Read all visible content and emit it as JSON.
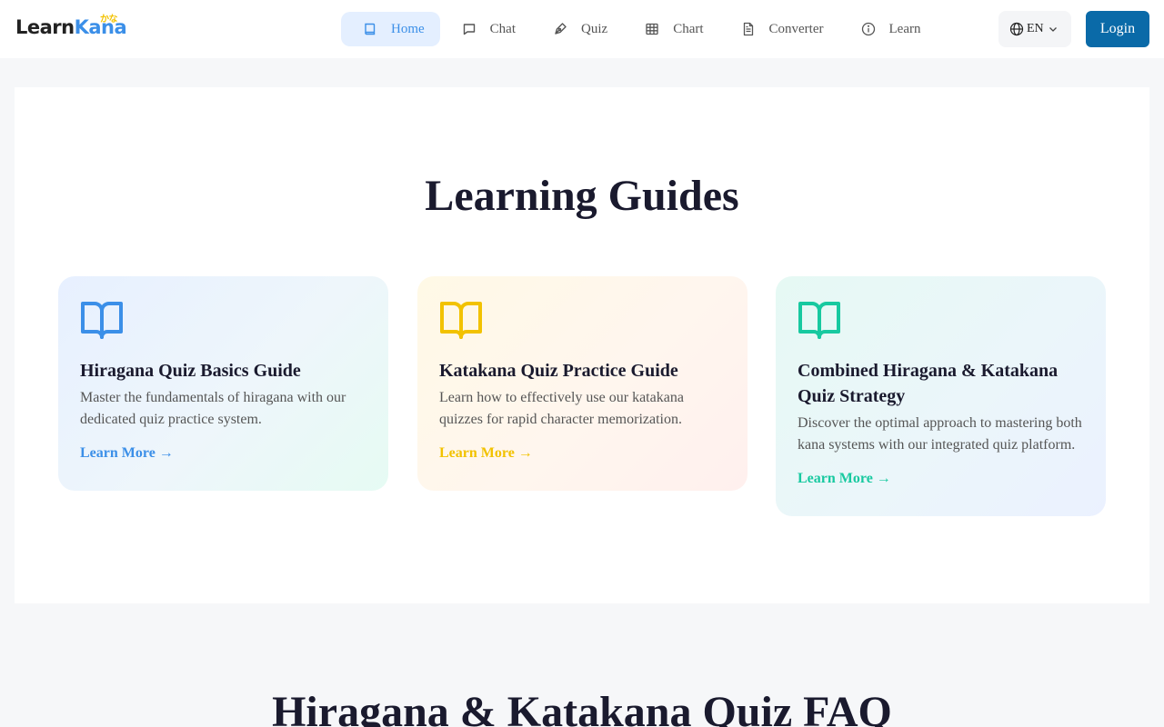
{
  "header": {
    "logo_learn": "Learn",
    "logo_kana": "Kana",
    "logo_sup": "かな",
    "nav": [
      {
        "label": "Home",
        "icon": "book-icon",
        "active": true
      },
      {
        "label": "Chat",
        "icon": "chat-icon"
      },
      {
        "label": "Quiz",
        "icon": "pen-icon"
      },
      {
        "label": "Chart",
        "icon": "table-icon"
      },
      {
        "label": "Converter",
        "icon": "document-icon"
      },
      {
        "label": "Learn",
        "icon": "info-icon"
      }
    ],
    "language": "EN",
    "login_label": "Login"
  },
  "guides": {
    "title": "Learning Guides",
    "cards": [
      {
        "title": "Hiragana Quiz Basics Guide",
        "description": "Master the fundamentals of hiragana with our dedicated quiz practice system.",
        "link": "Learn More →",
        "color": "#3b8fe8"
      },
      {
        "title": "Katakana Quiz Practice Guide",
        "description": "Learn how to effectively use our katakana quizzes for rapid character memorization.",
        "link": "Learn More →",
        "color": "#f2c200"
      },
      {
        "title": "Combined Hiragana & Katakana Quiz Strategy",
        "description": "Discover the optimal approach to mastering both kana systems with our integrated quiz platform.",
        "link": "Learn More →",
        "color": "#18c9a0"
      }
    ]
  },
  "faq": {
    "title": "Hiragana & Katakana Quiz FAQ"
  },
  "colors": {
    "accent": "#3b8fe8",
    "login_bg": "#0a6aa8"
  }
}
